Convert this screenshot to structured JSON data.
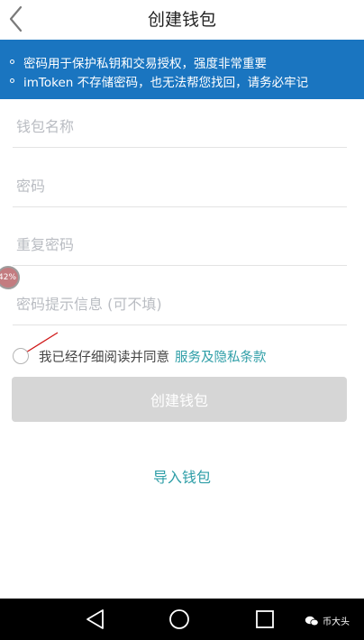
{
  "header": {
    "title": "创建钱包"
  },
  "notice": {
    "lines": [
      "密码用于保护私钥和交易授权，强度非常重要",
      "imToken 不存储密码，也无法帮您找回，请务必牢记"
    ]
  },
  "form": {
    "wallet_name_placeholder": "钱包名称",
    "password_placeholder": "密码",
    "repeat_password_placeholder": "重复密码",
    "hint_placeholder": "密码提示信息 (可不填)"
  },
  "agreement": {
    "text": "我已经仔细阅读并同意",
    "link": "服务及隐私条款",
    "checked": false
  },
  "overlay_badge": "42%",
  "create_button": "创建钱包",
  "import_link": "导入钱包",
  "watermark": "币大头",
  "colors": {
    "notice_bg": "#1a75c0",
    "link": "#2e9ea7",
    "button_disabled": "#d6d6d6",
    "annotation": "#d01818"
  }
}
